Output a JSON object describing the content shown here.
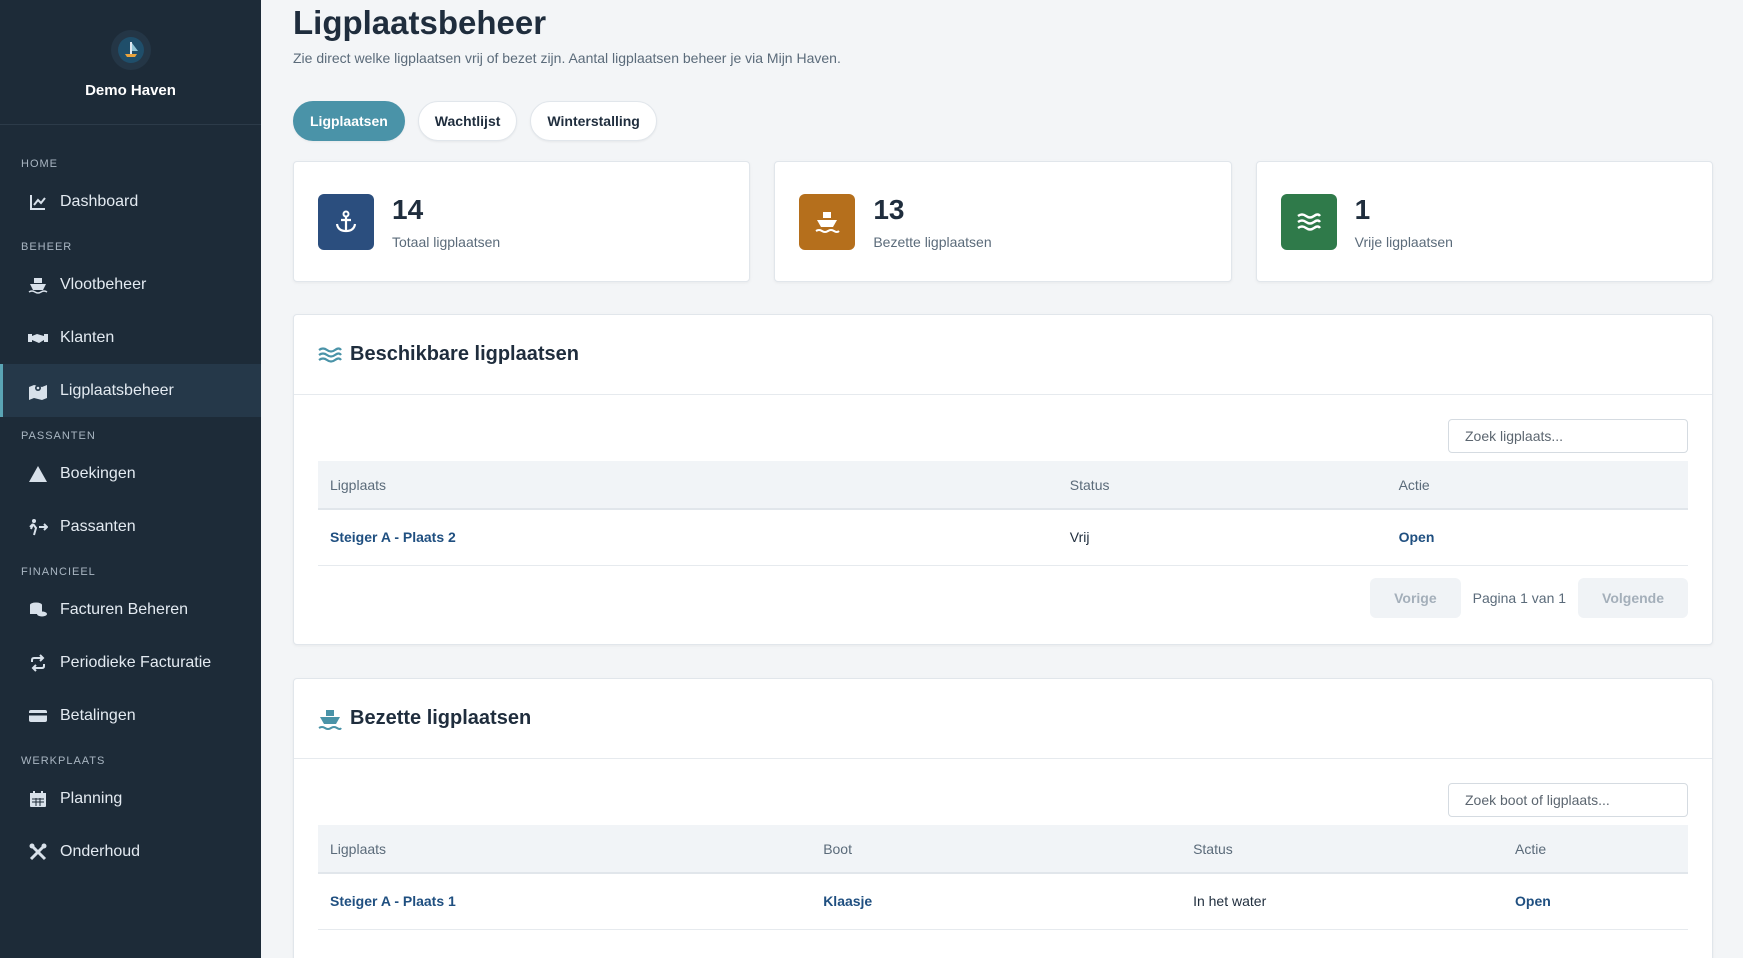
{
  "sidebar": {
    "brand": "Demo Haven",
    "sections": {
      "home": "HOME",
      "beheer": "BEHEER",
      "passanten": "PASSANTEN",
      "financieel": "FINANCIEEL",
      "werkplaats": "WERKPLAATS"
    },
    "items": {
      "dashboard": "Dashboard",
      "vlootbeheer": "Vlootbeheer",
      "klanten": "Klanten",
      "ligplaatsbeheer": "Ligplaatsbeheer",
      "boekingen": "Boekingen",
      "passanten": "Passanten",
      "facturen": "Facturen Beheren",
      "periodiek": "Periodieke Facturatie",
      "betalingen": "Betalingen",
      "planning": "Planning",
      "onderhoud": "Onderhoud"
    }
  },
  "header": {
    "title": "Ligplaatsbeheer",
    "subtitle": "Zie direct welke ligplaatsen vrij of bezet zijn. Aantal ligplaatsen beheer je via Mijn Haven."
  },
  "tabs": [
    "Ligplaatsen",
    "Wachtlijst",
    "Winterstalling"
  ],
  "stats": [
    {
      "value": "14",
      "label": "Totaal ligplaatsen",
      "color": "#2b4e7e",
      "icon": "anchor-icon"
    },
    {
      "value": "13",
      "label": "Bezette ligplaatsen",
      "color": "#b56f1c",
      "icon": "ship-icon"
    },
    {
      "value": "1",
      "label": "Vrije ligplaatsen",
      "color": "#2f7a4a",
      "icon": "water-icon"
    }
  ],
  "available": {
    "title": "Beschikbare ligplaatsen",
    "search_placeholder": "Zoek ligplaats...",
    "columns": [
      "Ligplaats",
      "Status",
      "Actie"
    ],
    "rows": [
      {
        "ligplaats": "Steiger A - Plaats 2",
        "status": "Vrij",
        "actie": "Open"
      }
    ],
    "pager": {
      "prev": "Vorige",
      "info": "Pagina 1 van 1",
      "next": "Volgende"
    }
  },
  "occupied": {
    "title": "Bezette ligplaatsen",
    "search_placeholder": "Zoek boot of ligplaats...",
    "columns": [
      "Ligplaats",
      "Boot",
      "Status",
      "Actie"
    ],
    "rows": [
      {
        "ligplaats": "Steiger A - Plaats 1",
        "boot": "Klaasje",
        "status": "In het water",
        "actie": "Open"
      }
    ]
  },
  "colors": {
    "accent": "#4a93a8",
    "sidebar": "#1d2b38",
    "link": "#1f4f80"
  }
}
